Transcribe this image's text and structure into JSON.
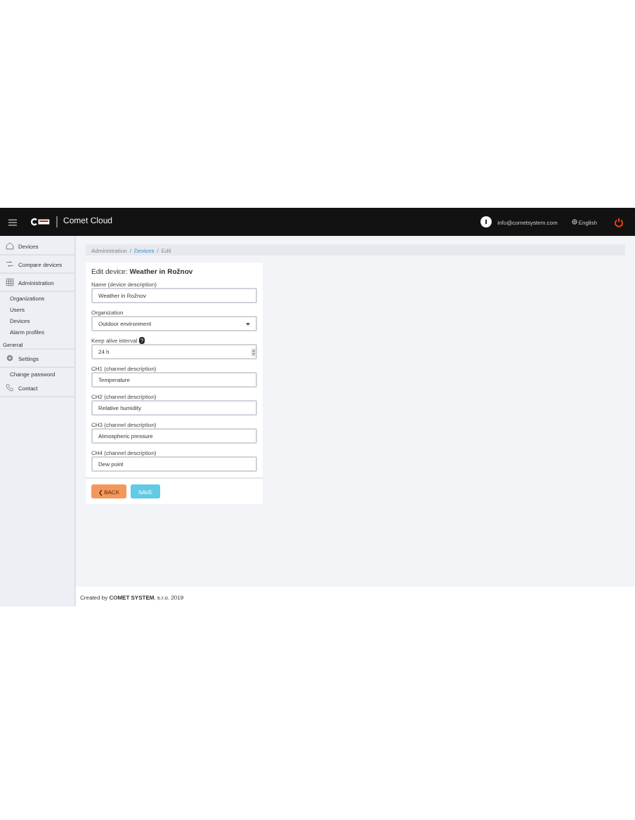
{
  "header": {
    "title": "Comet Cloud",
    "email": "info@cometsystem.com",
    "language": "English"
  },
  "sidebar": {
    "items": [
      {
        "label": "Devices",
        "kind": "main"
      },
      {
        "label": "Compare devices",
        "kind": "main"
      },
      {
        "label": "Administration",
        "kind": "main"
      },
      {
        "label": "Organizations",
        "kind": "sub"
      },
      {
        "label": "Users",
        "kind": "sub"
      },
      {
        "label": "Devices",
        "kind": "sub"
      },
      {
        "label": "Alarm profiles",
        "kind": "sub"
      },
      {
        "label": "General",
        "kind": "section"
      },
      {
        "label": "Settings",
        "kind": "main"
      },
      {
        "label": "Change password",
        "kind": "sub"
      },
      {
        "label": "Contact",
        "kind": "main"
      }
    ]
  },
  "breadcrumb": {
    "separator": "/",
    "items": [
      {
        "label": "Administration",
        "link": false
      },
      {
        "label": "Devices",
        "link": true
      },
      {
        "label": "Edit",
        "link": false
      }
    ]
  },
  "form": {
    "title": "Edit device: **Weather in Rožnov**",
    "fields": [
      {
        "label": "Name (device description)",
        "value": "Weather in Rožnov",
        "kind": "text"
      },
      {
        "label": "Organization",
        "value": "Outdoor environment",
        "kind": "select"
      },
      {
        "label": "Keep alive interval",
        "value": "24 h",
        "kind": "number",
        "help": "?"
      },
      {
        "label": "CH1 (channel description)",
        "value": "Temperature",
        "kind": "text"
      },
      {
        "label": "CH2 (channel description)",
        "value": "Relative humidity",
        "kind": "text"
      },
      {
        "label": "CH3 (channel description)",
        "value": "Atmospheric pressure",
        "kind": "text"
      },
      {
        "label": "CH4 (channel description)",
        "value": "Dew point",
        "kind": "text"
      }
    ],
    "back": "❮ BACK",
    "save": "SAVE"
  },
  "footer": "Created by **COMET SYSTEM**, s.r.o. 2019"
}
